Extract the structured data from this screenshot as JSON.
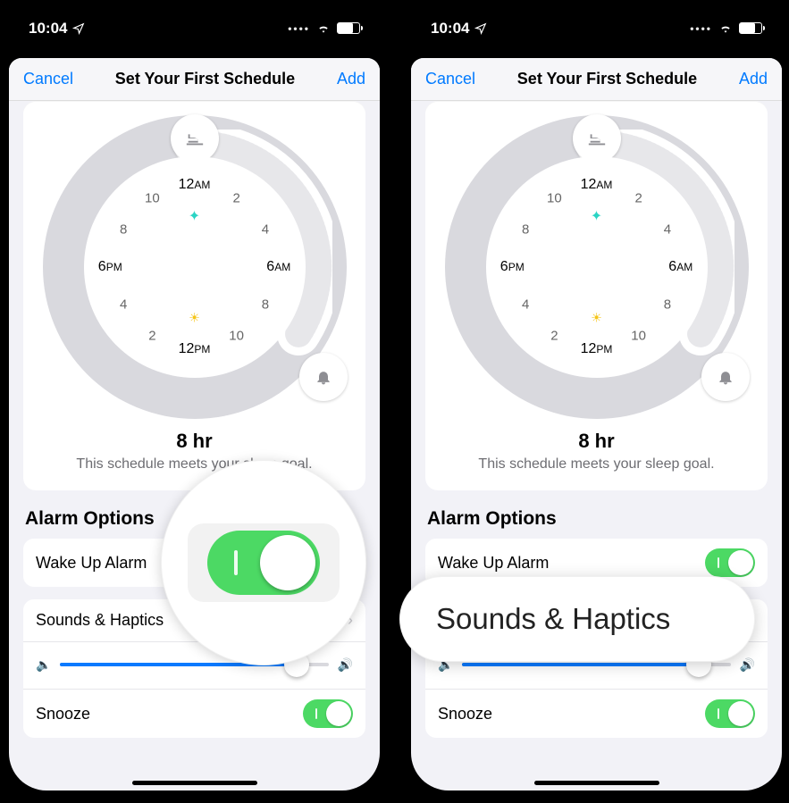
{
  "status": {
    "time": "10:04"
  },
  "sheet": {
    "cancel": "Cancel",
    "title": "Set Your First Schedule",
    "add": "Add"
  },
  "dial": {
    "top": {
      "num": "12",
      "ampm": "AM"
    },
    "right": {
      "num": "6",
      "ampm": "AM"
    },
    "bottom": {
      "num": "12",
      "ampm": "PM"
    },
    "left": {
      "num": "6",
      "ampm": "PM"
    },
    "n2": "2",
    "n4": "4",
    "n8": "8",
    "n10": "10",
    "b2": "2",
    "b4": "4",
    "b8": "8",
    "b10": "10"
  },
  "duration": "8 hr",
  "goal_text": "This schedule meets your sleep goal.",
  "section_title": "Alarm Options",
  "rows": {
    "wake": "Wake Up Alarm",
    "sounds": "Sounds & Haptics",
    "snooze": "Snooze"
  },
  "magnifier_pill": "Sounds & Haptics"
}
